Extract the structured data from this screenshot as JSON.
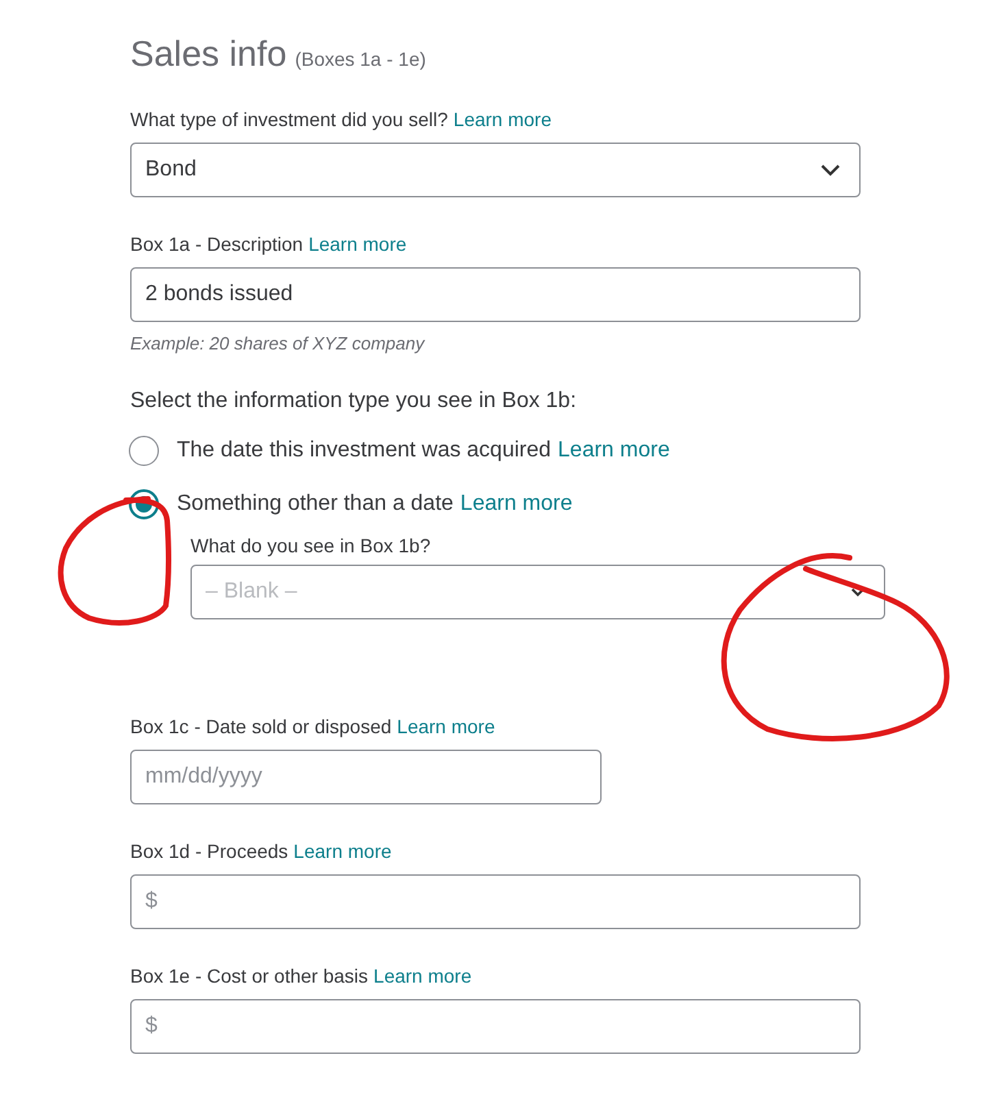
{
  "title": "Sales info",
  "subtitle": "(Boxes 1a - 1e)",
  "fields": [
    {
      "kind": "select",
      "label": "What type of investment did you sell?",
      "link": "Learn more",
      "value": "Bond"
    },
    {
      "kind": "text",
      "label": "Box 1a - Description",
      "link": "Learn more",
      "value": "2 bonds issued",
      "hint": "Example: 20 shares of XYZ company"
    },
    {
      "kind": "radio",
      "label": "Select the information type you see in Box 1b:",
      "options": [
        {
          "label": "The date this investment was acquired",
          "link": "Learn more",
          "selected": false
        },
        {
          "label": "Something other than a date",
          "link": "Learn more",
          "selected": true
        }
      ],
      "sub": {
        "label": "What do you see in Box 1b?",
        "placeholder": "– Blank –"
      }
    },
    {
      "kind": "date",
      "label": "Box 1c - Date sold or disposed",
      "link": "Learn more",
      "placeholder": "mm/dd/yyyy"
    },
    {
      "kind": "currency",
      "label": "Box 1d - Proceeds",
      "link": "Learn more",
      "prefix": "$"
    },
    {
      "kind": "currency",
      "label": "Box 1e - Cost or other basis",
      "link": "Learn more",
      "prefix": "$"
    }
  ],
  "annotations": [
    {
      "kind": "circle"
    },
    {
      "kind": "circle"
    }
  ]
}
